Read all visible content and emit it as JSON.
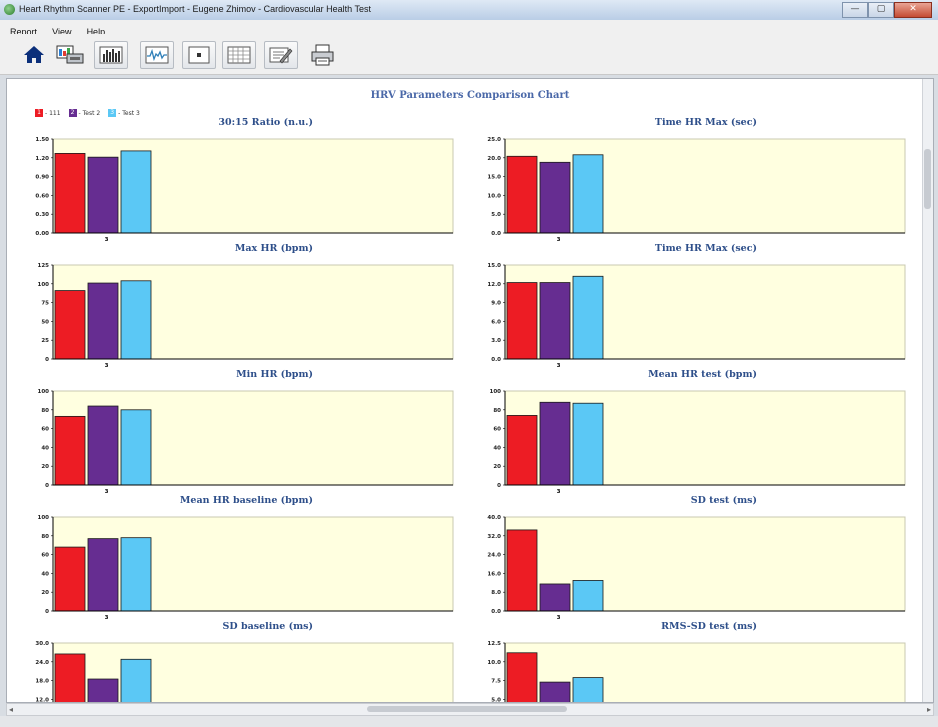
{
  "window": {
    "title": "Heart Rhythm Scanner PE - ExportImport - Eugene Zhimov - Cardiovascular Health Test",
    "controls": [
      "—",
      "▢",
      "✕"
    ]
  },
  "menu": [
    "Report",
    "View",
    "Help"
  ],
  "toolbar": [
    {
      "name": "home-button",
      "icon": "home-icon"
    },
    {
      "name": "export-button",
      "icon": "export-icon"
    },
    {
      "name": "histogram-button",
      "icon": "histogram-icon"
    },
    {
      "name": "wave-button",
      "icon": "waveform-icon"
    },
    {
      "name": "record-button",
      "icon": "record-icon"
    },
    {
      "name": "grid-button",
      "icon": "grid-icon"
    },
    {
      "name": "compare-button",
      "icon": "compare-chart-icon"
    },
    {
      "name": "print-button",
      "icon": "printer-icon"
    }
  ],
  "report": {
    "title": "HRV Parameters Comparison Chart",
    "legend": [
      {
        "tag": "1",
        "label": "- 111",
        "color": "#ed1c24"
      },
      {
        "tag": "2",
        "label": "- Test 2",
        "color": "#662d91"
      },
      {
        "tag": "3",
        "label": "- Test 3",
        "color": "#5bc8f5"
      }
    ],
    "colors": {
      "plot_bg": "#ffffe0",
      "axis": "#000000",
      "title": "#2e4f8a"
    }
  },
  "chart_data": [
    {
      "type": "bar",
      "title": "30:15 Ratio (n.u.)",
      "categories": [
        "3"
      ],
      "series": [
        {
          "name": "111",
          "values": [
            1.27
          ]
        },
        {
          "name": "Test 2",
          "values": [
            1.21
          ]
        },
        {
          "name": "Test 3",
          "values": [
            1.31
          ]
        }
      ],
      "ylim": [
        0,
        1.5
      ],
      "yticks": [
        "1.50",
        "1.20",
        "0.90",
        "0.60",
        "0.30",
        "0.00"
      ]
    },
    {
      "type": "bar",
      "title": "Time HR Max (sec)",
      "categories": [
        "3"
      ],
      "series": [
        {
          "name": "111",
          "values": [
            20.4
          ]
        },
        {
          "name": "Test 2",
          "values": [
            18.8
          ]
        },
        {
          "name": "Test 3",
          "values": [
            20.8
          ]
        }
      ],
      "ylim": [
        0,
        25
      ],
      "yticks": [
        "25.0",
        "20.0",
        "15.0",
        "10.0",
        "5.0",
        "0.0"
      ]
    },
    {
      "type": "bar",
      "title": "Max HR (bpm)",
      "categories": [
        "3"
      ],
      "series": [
        {
          "name": "111",
          "values": [
            91
          ]
        },
        {
          "name": "Test 2",
          "values": [
            101
          ]
        },
        {
          "name": "Test 3",
          "values": [
            104
          ]
        }
      ],
      "ylim": [
        0,
        125
      ],
      "yticks": [
        "125",
        "100",
        "75",
        "50",
        "25",
        "0"
      ]
    },
    {
      "type": "bar",
      "title": "Time HR Max (sec)",
      "categories": [
        "3"
      ],
      "series": [
        {
          "name": "111",
          "values": [
            12.2
          ]
        },
        {
          "name": "Test 2",
          "values": [
            12.2
          ]
        },
        {
          "name": "Test 3",
          "values": [
            13.2
          ]
        }
      ],
      "ylim": [
        0,
        15
      ],
      "yticks": [
        "15.0",
        "12.0",
        "9.0",
        "6.0",
        "3.0",
        "0.0"
      ]
    },
    {
      "type": "bar",
      "title": "Min HR (bpm)",
      "categories": [
        "3"
      ],
      "series": [
        {
          "name": "111",
          "values": [
            73
          ]
        },
        {
          "name": "Test 2",
          "values": [
            84
          ]
        },
        {
          "name": "Test 3",
          "values": [
            80
          ]
        }
      ],
      "ylim": [
        0,
        100
      ],
      "yticks": [
        "100",
        "80",
        "60",
        "40",
        "20",
        "0"
      ]
    },
    {
      "type": "bar",
      "title": "Mean HR test (bpm)",
      "categories": [
        "3"
      ],
      "series": [
        {
          "name": "111",
          "values": [
            74
          ]
        },
        {
          "name": "Test 2",
          "values": [
            88
          ]
        },
        {
          "name": "Test 3",
          "values": [
            87
          ]
        }
      ],
      "ylim": [
        0,
        100
      ],
      "yticks": [
        "100",
        "80",
        "60",
        "40",
        "20",
        "0"
      ]
    },
    {
      "type": "bar",
      "title": "Mean HR baseline (bpm)",
      "categories": [
        "3"
      ],
      "series": [
        {
          "name": "111",
          "values": [
            68
          ]
        },
        {
          "name": "Test 2",
          "values": [
            77
          ]
        },
        {
          "name": "Test 3",
          "values": [
            78
          ]
        }
      ],
      "ylim": [
        0,
        100
      ],
      "yticks": [
        "100",
        "80",
        "60",
        "40",
        "20",
        "0"
      ]
    },
    {
      "type": "bar",
      "title": "SD test (ms)",
      "categories": [
        "3"
      ],
      "series": [
        {
          "name": "111",
          "values": [
            34.5
          ]
        },
        {
          "name": "Test 2",
          "values": [
            11.5
          ]
        },
        {
          "name": "Test 3",
          "values": [
            13
          ]
        }
      ],
      "ylim": [
        0,
        40
      ],
      "yticks": [
        "40.0",
        "32.0",
        "24.0",
        "16.0",
        "8.0",
        "0.0"
      ]
    },
    {
      "type": "bar",
      "title": "SD baseline (ms)",
      "categories": [
        "3"
      ],
      "series": [
        {
          "name": "111",
          "values": [
            26.5
          ]
        },
        {
          "name": "Test 2",
          "values": [
            18.5
          ]
        },
        {
          "name": "Test 3",
          "values": [
            24.8
          ]
        }
      ],
      "ylim": [
        0,
        30
      ],
      "yticks": [
        "30.0",
        "24.0",
        "18.0",
        "12.0"
      ]
    },
    {
      "type": "bar",
      "title": "RMS-SD test (ms)",
      "categories": [
        "3"
      ],
      "series": [
        {
          "name": "111",
          "values": [
            11.2
          ]
        },
        {
          "name": "Test 2",
          "values": [
            7.3
          ]
        },
        {
          "name": "Test 3",
          "values": [
            7.9
          ]
        }
      ],
      "ylim": [
        0,
        12.5
      ],
      "yticks": [
        "12.5",
        "10.0",
        "7.5",
        "5.0"
      ]
    }
  ]
}
